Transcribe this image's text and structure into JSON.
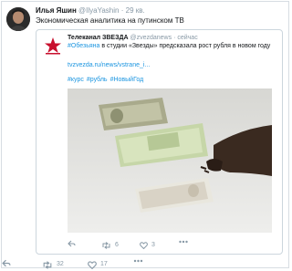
{
  "tweet": {
    "author_name": "Илья Яшин",
    "handle": "@IlyaYashin",
    "separator": "·",
    "time": "29 кв.",
    "text": "Экономическая аналитика на путинском ТВ"
  },
  "quoted": {
    "author_name": "Телеканал ЗВЕЗДА",
    "handle": "@zvezdanews",
    "separator": "·",
    "time": "сейчас",
    "text_hashtag": "#Обезьяна",
    "text_body": "в студии «Звезды» предсказала рост рубля в новом году",
    "url": "tvzvezda.ru/news/vstrane_i...",
    "hashtags": [
      "#курс",
      "#рубль",
      "#НовыйГод"
    ],
    "actions": {
      "retweets": "6",
      "likes": "3"
    }
  },
  "actions": {
    "retweets": "32",
    "likes": "17"
  },
  "colors": {
    "link": "#1b95e0",
    "muted": "#8899a6",
    "border": "#ccd6dd",
    "logo_red": "#c8102e"
  },
  "icons": [
    "reply-icon",
    "retweet-icon",
    "like-icon",
    "more-icon"
  ]
}
